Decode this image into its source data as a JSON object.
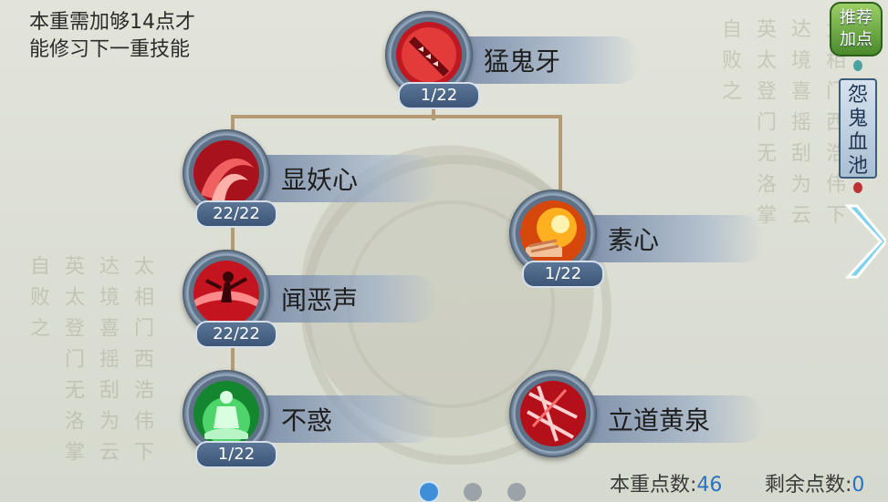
{
  "hint": "本重需加够14点才能修习下一重技能",
  "hint_lines": [
    "本重需加够14点才",
    "能修习下一重技能"
  ],
  "background_text": {
    "left": "太相门西浩伟下达境喜摇刮为云英太登门无洛掌自败之",
    "right": "太相门西浩伟下达境喜摇刮为云英太登门无洛掌自败之"
  },
  "skills": [
    {
      "name": "猛鬼牙",
      "level": "1/22",
      "icon": "red-fang-icon"
    },
    {
      "name": "显妖心",
      "level": "22/22",
      "icon": "red-swirl-icon"
    },
    {
      "name": "素心",
      "level": "1/22",
      "icon": "fire-hand-icon"
    },
    {
      "name": "闻恶声",
      "level": "22/22",
      "icon": "red-dancer-icon"
    },
    {
      "name": "不惑",
      "level": "1/22",
      "icon": "green-meditation-icon"
    },
    {
      "name": "立道黄泉",
      "level": "",
      "icon": "red-slash-icon"
    }
  ],
  "side": {
    "recommend_label_1": "推荐",
    "recommend_label_2": "加点",
    "tag_label": "怨鬼血池"
  },
  "footer": {
    "current_label": "本重点数:",
    "current_value": "46",
    "remaining_label": "剩余点数:",
    "remaining_value": "0"
  },
  "colors": {
    "accent": "#3e8ed8",
    "connector": "#b49b74",
    "banner": "#6e82a0"
  }
}
